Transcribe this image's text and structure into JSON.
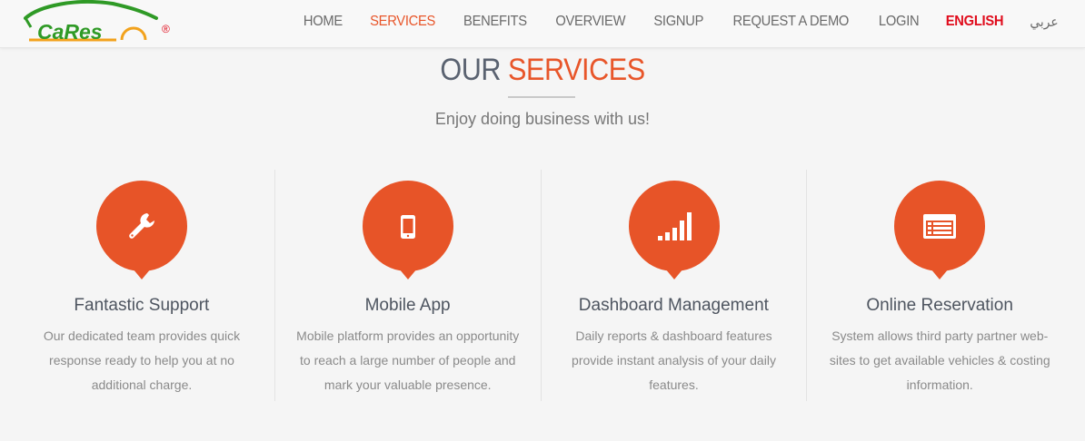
{
  "brand": {
    "logo_text": "CaRes",
    "registered_mark": "®",
    "colors": {
      "green": "#2f9a26",
      "orange": "#f2a21c",
      "red": "#e00c1c"
    }
  },
  "nav": {
    "items": [
      {
        "label": "HOME",
        "active": false
      },
      {
        "label": "SERVICES",
        "active": true
      },
      {
        "label": "BENEFITS",
        "active": false
      },
      {
        "label": "OVERVIEW",
        "active": false
      },
      {
        "label": "SIGNUP",
        "active": false
      },
      {
        "label": "REQUEST A DEMO",
        "active": false
      },
      {
        "label": "LOGIN",
        "active": false
      }
    ],
    "lang_english": "ENGLISH",
    "lang_arabic": "عربي"
  },
  "section": {
    "title_part1": "OUR",
    "title_part2": "SERVICES",
    "subtitle": "Enjoy doing business with us!"
  },
  "services": [
    {
      "icon": "wrench-icon",
      "title": "Fantastic Support",
      "description": "Our dedicated team provides quick response ready to help you at no additional charge."
    },
    {
      "icon": "mobile-phone-icon",
      "title": "Mobile App",
      "description": "Mobile platform provides an opportunity to reach a large number of people and mark your valuable presence."
    },
    {
      "icon": "signal-bars-icon",
      "title": "Dashboard Management",
      "description": "Daily reports & dashboard features provide instant analysis of your daily features."
    },
    {
      "icon": "list-browser-icon",
      "title": "Online Reservation",
      "description": "System allows third party partner web-sites to get available vehicles & costing information."
    }
  ],
  "accent_color": "#e75428"
}
